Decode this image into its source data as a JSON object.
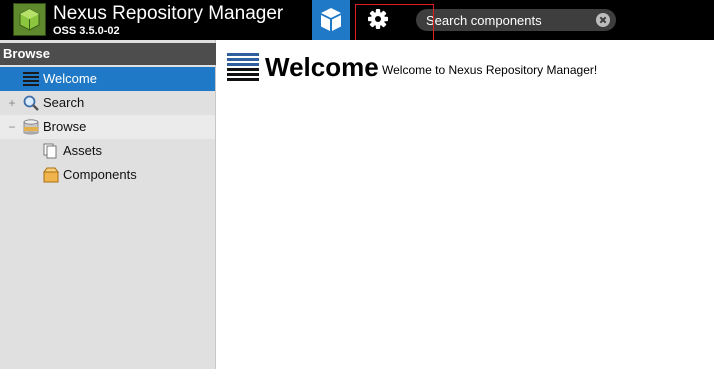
{
  "header": {
    "title": "Nexus Repository Manager",
    "version": "OSS 3.5.0-02",
    "nav": [
      {
        "name": "browse",
        "icon": "cube-icon",
        "active": true
      },
      {
        "name": "administration",
        "icon": "gear-icon",
        "active": false
      }
    ],
    "search": {
      "placeholder": "Search components",
      "value": ""
    }
  },
  "sidebar": {
    "title": "Browse",
    "items": [
      {
        "label": "Welcome",
        "icon": "list-lines-icon",
        "selected": true
      },
      {
        "label": "Search",
        "icon": "magnifier-icon",
        "toggle": "+"
      },
      {
        "label": "Browse",
        "icon": "database-icon",
        "toggle": "−"
      },
      {
        "label": "Assets",
        "icon": "documents-icon"
      },
      {
        "label": "Components",
        "icon": "box-icon"
      }
    ]
  },
  "main": {
    "title": "Welcome",
    "subtitle": "Welcome to Nexus Repository Manager!"
  },
  "colors": {
    "header_bg": "#000000",
    "accent": "#1f79c6",
    "sidebar_bg": "#e0e0e0",
    "sidebar_header_bg": "#4d4d4d",
    "highlight": "#e02020"
  }
}
